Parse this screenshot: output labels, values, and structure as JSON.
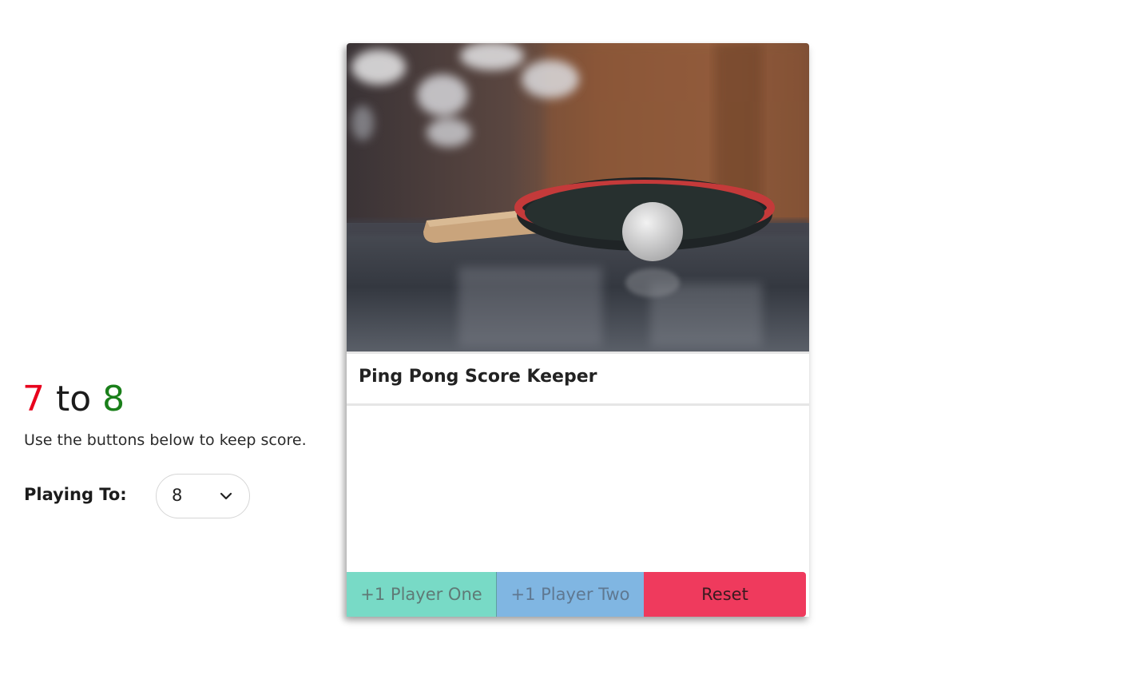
{
  "card": {
    "title": "Ping Pong Score Keeper",
    "image_description_icon": "ping-pong-paddle-photo"
  },
  "score": {
    "player_one": "7",
    "separator": "to",
    "player_two": "8",
    "player_one_color": "#e8001c",
    "player_two_color": "#1a7f1a"
  },
  "hint": "Use the buttons below to keep score.",
  "playing_to": {
    "label": "Playing To:",
    "selected_value": "8",
    "icon": "chevron-down-icon"
  },
  "buttons": {
    "player_one_label": "+1 Player One",
    "player_two_label": "+1 Player Two",
    "reset_label": "Reset",
    "player_one_color": "#78dac6",
    "player_two_color": "#80b6e2",
    "reset_color": "#ef3a5d"
  }
}
